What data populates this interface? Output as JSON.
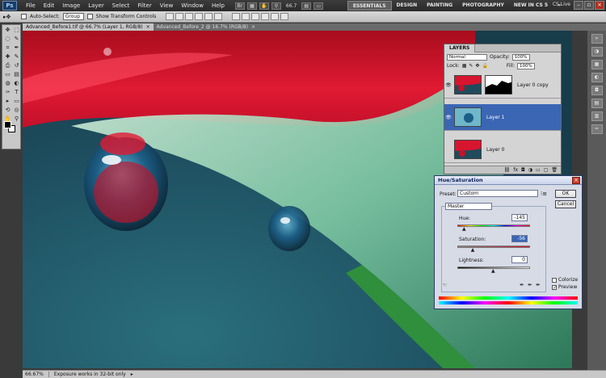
{
  "app": {
    "logo": "Ps"
  },
  "menu": {
    "items": [
      "File",
      "Edit",
      "Image",
      "Layer",
      "Select",
      "Filter",
      "View",
      "Window",
      "Help"
    ],
    "zoom": "66.7",
    "workspaces": [
      "ESSENTIALS",
      "DESIGN",
      "PAINTING",
      "PHOTOGRAPHY",
      "NEW IN CS 5"
    ],
    "active_workspace": "ESSENTIALS",
    "more": "»",
    "cs_live": "CS Live"
  },
  "options": {
    "auto_select_label": "Auto-Select:",
    "auto_select_value": "Group",
    "show_transform_label": "Show Transform Controls"
  },
  "tabs": [
    {
      "label": "Advanced_Before1.tif @ 66.7% (Layer 1, RGB/8)",
      "active": true
    },
    {
      "label": "Advanced_Before_2 @ 16.7% (RGB/8)",
      "active": false
    }
  ],
  "toolbox": {
    "tools": [
      "move-icon",
      "marquee-icon",
      "lasso-icon",
      "quick-select-icon",
      "crop-icon",
      "eyedropper-icon",
      "healing-icon",
      "brush-icon",
      "stamp-icon",
      "history-brush-icon",
      "eraser-icon",
      "gradient-icon",
      "blur-icon",
      "dodge-icon",
      "pen-icon",
      "type-icon",
      "path-select-icon",
      "shape-icon",
      "3d-rotate-icon",
      "3d-orbit-icon",
      "hand-icon",
      "zoom-icon"
    ],
    "glyphs": [
      "✥",
      "⬚",
      "◌",
      "✎",
      "⌗",
      "✒",
      "✚",
      "✎",
      "⎙",
      "↺",
      "▭",
      "▤",
      "◍",
      "◐",
      "✑",
      "T",
      "▸",
      "▭",
      "⟲",
      "◎",
      "✋",
      "⚲"
    ]
  },
  "status": {
    "zoom": "66.67%",
    "info": "Exposure works in 32-bit only",
    "arrow": "▸"
  },
  "layers": {
    "tab": "LAYERS",
    "blend_mode": "Normal",
    "opacity_label": "Opacity:",
    "opacity": "100%",
    "lock_label": "Lock:",
    "fill_label": "Fill:",
    "fill": "100%",
    "items": [
      {
        "name": "Layer 0 copy",
        "selected": false,
        "visible": true
      },
      {
        "name": "Layer 1",
        "selected": true,
        "visible": true
      },
      {
        "name": "Layer 0",
        "selected": false,
        "visible": false
      }
    ],
    "footer_icons": [
      "link-icon",
      "fx-icon",
      "mask-icon",
      "adjustment-icon",
      "folder-icon",
      "new-layer-icon",
      "trash-icon"
    ],
    "footer_glyphs": [
      "⛓",
      "fx",
      "◘",
      "◑",
      "▭",
      "▢",
      "🗑"
    ]
  },
  "dialog": {
    "title": "Hue/Saturation",
    "preset_label": "Preset:",
    "preset_value": "Custom",
    "ok": "OK",
    "cancel": "Cancel",
    "channel": "Master",
    "hue_label": "Hue:",
    "hue_value": "-145",
    "hue_level": 0.1,
    "saturation_label": "Saturation:",
    "saturation_value": "-56",
    "saturation_level": 0.22,
    "lightness_label": "Lightness:",
    "lightness_value": "0",
    "lightness_level": 0.5,
    "colorize_label": "Colorize",
    "colorize_checked": false,
    "preview_label": "Preview",
    "preview_checked": true
  },
  "colors": {
    "canvas_bg": "#1f4b5c",
    "petal_red": "#d8152e",
    "leaf_green": "#9fd4a8",
    "selection_blue": "#3a66b4"
  }
}
